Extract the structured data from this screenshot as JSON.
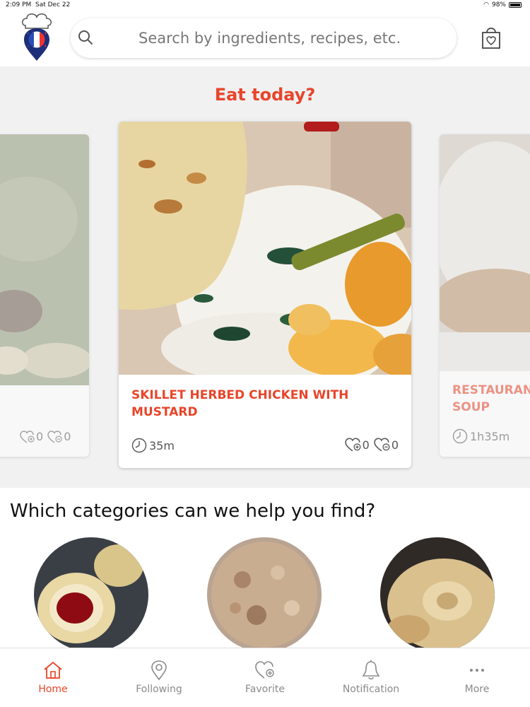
{
  "status_bar": {
    "time": "2:09 PM",
    "date": "Sat Dec 22",
    "battery": "98%"
  },
  "search": {
    "placeholder": "Search by ingredients, recipes, etc."
  },
  "featured": {
    "title": "Eat today?",
    "cards": [
      {
        "title": "",
        "time": "",
        "likes": "0",
        "favorites": "0"
      },
      {
        "title": "SKILLET HERBED CHICKEN WITH MUSTARD",
        "time": "35m",
        "likes": "0",
        "favorites": "0"
      },
      {
        "title": "RESTAURANT SOUP",
        "time": "1h35m",
        "likes": "",
        "favorites": ""
      }
    ]
  },
  "categories": {
    "title": "Which categories can we help you find?"
  },
  "tabs": [
    {
      "label": "Home",
      "icon": "home-icon",
      "active": true
    },
    {
      "label": "Following",
      "icon": "location-pin-icon"
    },
    {
      "label": "Favorite",
      "icon": "heart-plus-icon"
    },
    {
      "label": "Notification",
      "icon": "bell-icon"
    },
    {
      "label": "More",
      "icon": "more-dots-icon"
    }
  ],
  "colors": {
    "accent": "#e8452a",
    "background": "#f1f1f2",
    "inactive": "#8a8a8a"
  }
}
